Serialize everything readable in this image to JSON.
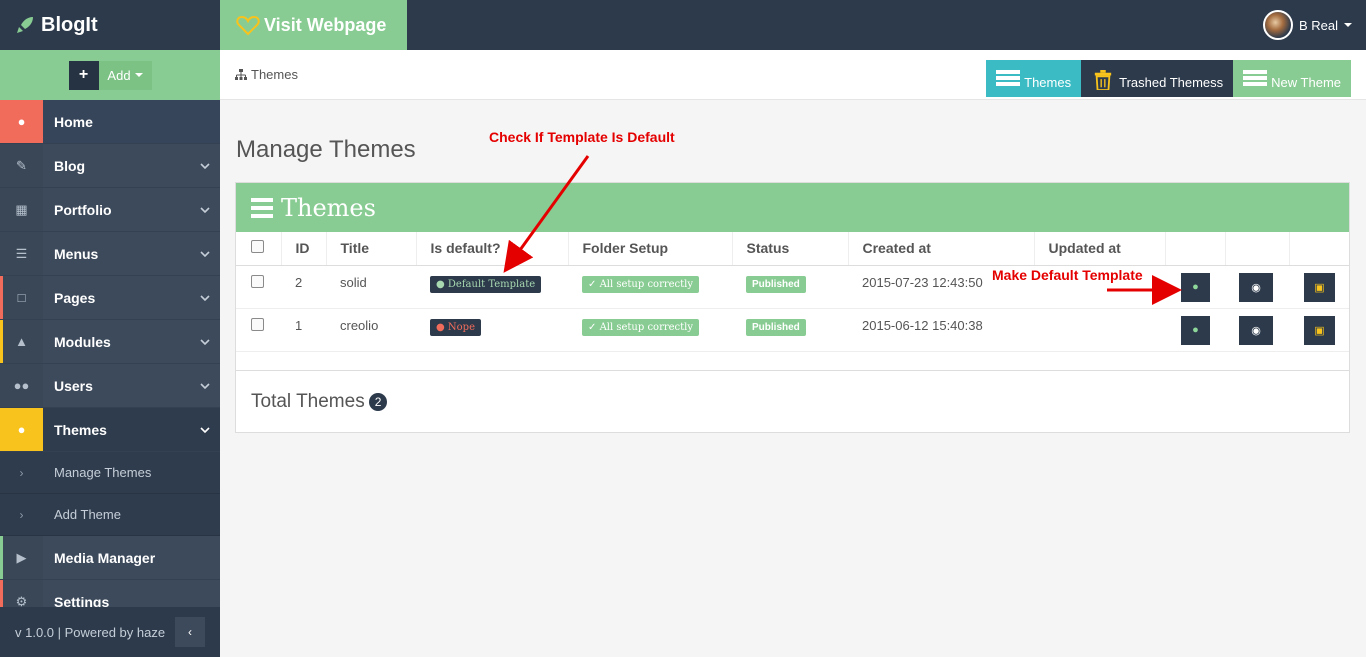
{
  "app": {
    "name": "BlogIt"
  },
  "topbar": {
    "visit_label": "Visit Webpage",
    "user_name": "B Real"
  },
  "sidebar": {
    "add_label": "Add",
    "items": [
      {
        "label": "Home",
        "icon": "bulb-icon"
      },
      {
        "label": "Blog",
        "icon": "edit-icon"
      },
      {
        "label": "Portfolio",
        "icon": "briefcase-icon"
      },
      {
        "label": "Menus",
        "icon": "list-icon"
      },
      {
        "label": "Pages",
        "icon": "file-icon"
      },
      {
        "label": "Modules",
        "icon": "sitemap-icon"
      },
      {
        "label": "Users",
        "icon": "users-icon"
      },
      {
        "label": "Themes",
        "icon": "drop-icon"
      },
      {
        "label": "Media Manager",
        "icon": "play-icon"
      },
      {
        "label": "Settings",
        "icon": "gears-icon"
      }
    ],
    "sub_items": [
      {
        "label": "Manage Themes"
      },
      {
        "label": "Add Theme"
      }
    ],
    "footer": "v 1.0.0 | Powered by haze"
  },
  "breadcrumb": {
    "label": "Themes"
  },
  "tabs": [
    {
      "label": "Themes",
      "color": "#3bbcc4"
    },
    {
      "label": "Trashed Themess",
      "color": "#2c3a4b"
    },
    {
      "label": "New Theme",
      "color": "#89cc93"
    }
  ],
  "main": {
    "page_title": "Manage Themes",
    "panel_title": "Themes",
    "columns": [
      "ID",
      "Title",
      "Is default?",
      "Folder Setup",
      "Status",
      "Created at",
      "Updated at"
    ],
    "rows": [
      {
        "id": "2",
        "title": "solid",
        "is_default": "Default Template",
        "folder": "All setup correctly",
        "status": "Published",
        "created": "2015-07-23 12:43:50",
        "updated": ""
      },
      {
        "id": "1",
        "title": "creolio",
        "is_default": "Nope",
        "folder": "All setup correctly",
        "status": "Published",
        "created": "2015-06-12 15:40:38",
        "updated": ""
      }
    ],
    "total_label": "Total Themes",
    "total_count": "2"
  },
  "annotations": {
    "check_default": "Check If Template Is Default",
    "make_default": "Make Default Template"
  },
  "colors": {
    "accent_green": "#89cc93",
    "dark": "#2c3a4b",
    "teal": "#3bbcc4",
    "annotation_red": "#e50000"
  }
}
